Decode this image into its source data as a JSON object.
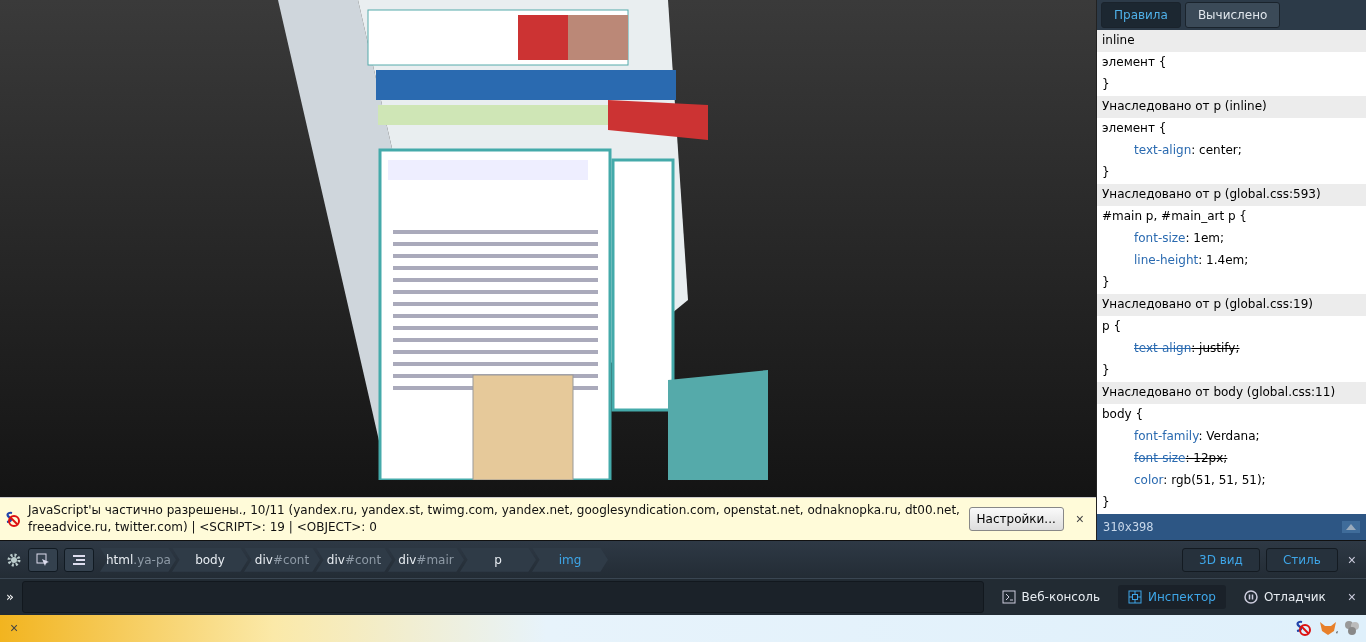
{
  "sidebar": {
    "tabs": [
      {
        "label": "Правила",
        "selected": true
      },
      {
        "label": "Вычислено",
        "selected": false
      }
    ],
    "rules": [
      {
        "header": "inline",
        "selector": "элемент {",
        "close": "}"
      },
      {
        "header": "Унаследовано от p (inline)",
        "selector": "элемент {",
        "properties": [
          {
            "name": "text-align",
            "value": ": center;",
            "overridden": false
          }
        ],
        "close": "}"
      },
      {
        "header": "Унаследовано от p (global.css:593)",
        "selector": "#main p, #main_art p {",
        "properties": [
          {
            "name": "font-size",
            "value": ": 1em;",
            "overridden": false
          },
          {
            "name": "line-height",
            "value": ": 1.4em;",
            "overridden": false
          }
        ],
        "close": "}"
      },
      {
        "header": "Унаследовано от p (global.css:19)",
        "selector": "p {",
        "properties": [
          {
            "name": "text-align",
            "value": ": justify;",
            "overridden": true
          }
        ],
        "close": "}"
      },
      {
        "header": "Унаследовано от body (global.css:11)",
        "selector": "body {",
        "properties": [
          {
            "name": "font-family",
            "value": ": Verdana;",
            "overridden": false
          },
          {
            "name": "font-size",
            "value": ": 12px;",
            "overridden": true
          },
          {
            "name": "color",
            "value": ": rgb(51, 51, 51);",
            "overridden": false
          }
        ],
        "close": "}"
      }
    ],
    "dimensions": "310x398"
  },
  "notification": {
    "message": "JavaScript'ы частично разрешены., 10/11 (yandex.ru, yandex.st, twimg.com, yandex.net, googlesyndication.com, openstat.net, odnaknopka.ru, dt00.net, freeadvice.ru, twitter.com) | <SCRIPT>: 19 | <OBJECT>: 0",
    "button": "Настройки...",
    "close": "×"
  },
  "breadcrumbs": [
    {
      "tag": "html",
      "suffix": ".ya-pa",
      "selected": false
    },
    {
      "tag": "body",
      "selected": false
    },
    {
      "tag": "div",
      "suffix": "#cont",
      "selected": false
    },
    {
      "tag": "div",
      "suffix": "#cont",
      "selected": false
    },
    {
      "tag": "div",
      "suffix": "#mair",
      "selected": false
    },
    {
      "tag": "p",
      "selected": false
    },
    {
      "tag": "img",
      "selected": true
    }
  ],
  "view_buttons": [
    "3D вид",
    "Стиль"
  ],
  "toolbar_close": "×",
  "command_prompt": "»",
  "toolbox_tabs": [
    {
      "label": "Веб-консоль",
      "kind": "console",
      "selected": false
    },
    {
      "label": "Инспектор",
      "kind": "inspector",
      "selected": true
    },
    {
      "label": "Отладчик",
      "kind": "debugger",
      "selected": false
    }
  ],
  "toolbox_close": "×",
  "addon_bar": {
    "close": "×"
  }
}
